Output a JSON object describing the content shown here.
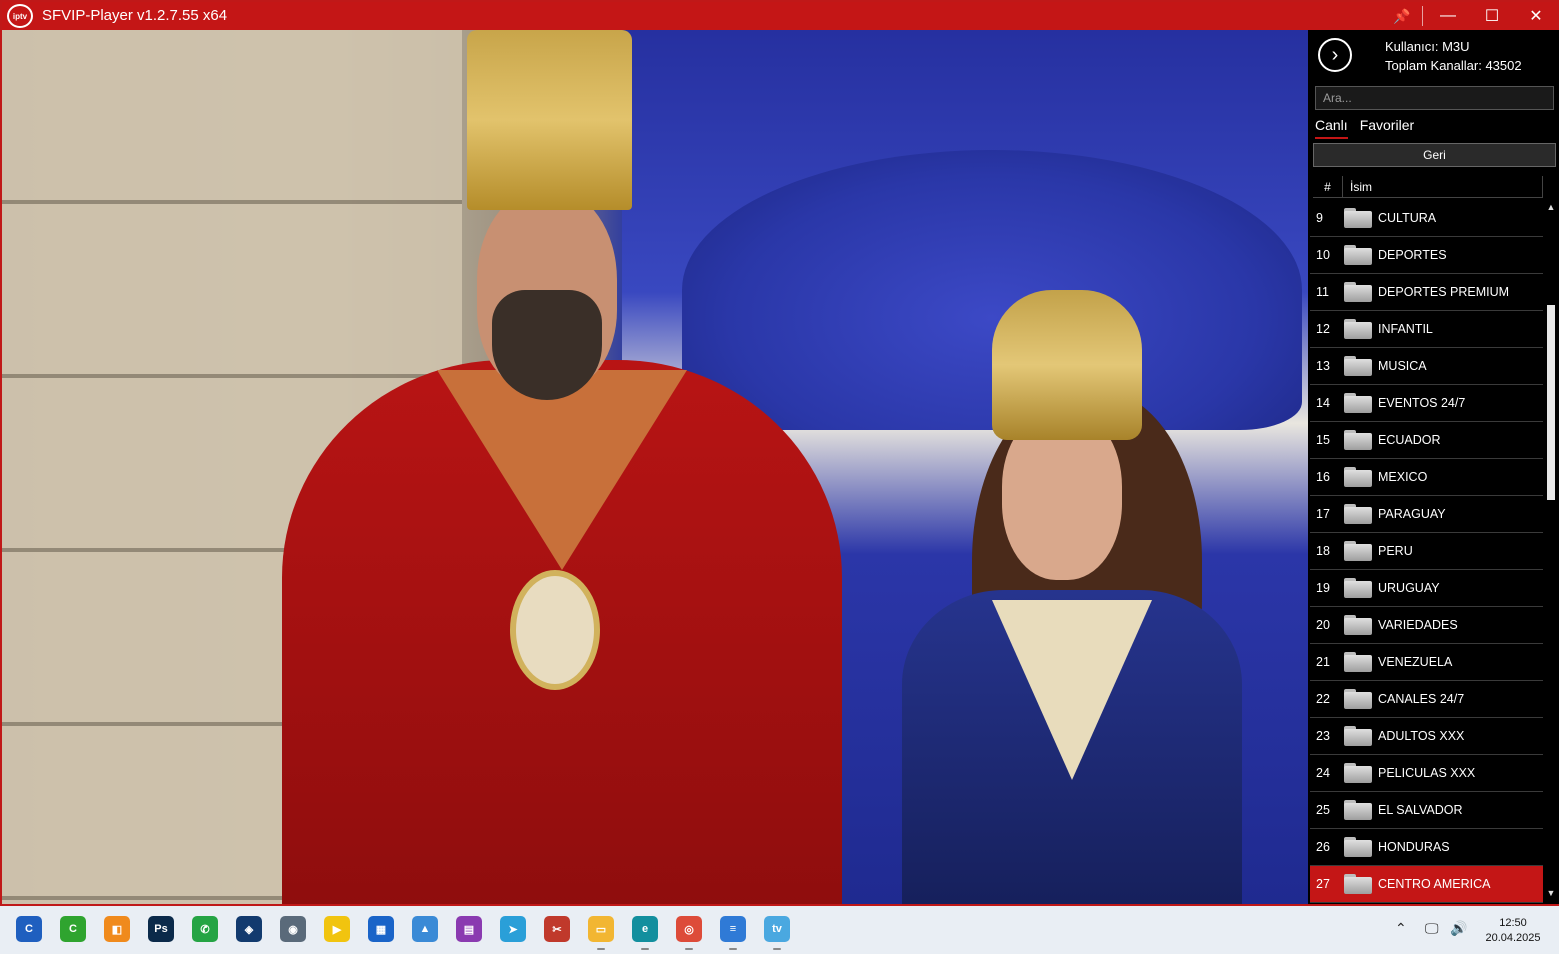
{
  "window": {
    "title": "SFVIP-Player v1.2.7.55 x64",
    "logo_text": "iptv",
    "accent": "#c41616"
  },
  "titlebar_buttons": {
    "pin": "📌",
    "minimize": "—",
    "maximize": "☐",
    "close": "✕"
  },
  "panel": {
    "nav_arrow": "›",
    "user_label": "Kullanıcı: M3U",
    "channels_label": "Toplam Kanallar: 43502",
    "search_placeholder": "Ara...",
    "tabs": [
      "Canlı",
      "Favoriler"
    ],
    "back_label": "Geri",
    "columns": {
      "num": "#",
      "name": "İsim"
    },
    "rows": [
      {
        "num": "9",
        "name": "CULTURA"
      },
      {
        "num": "10",
        "name": "DEPORTES"
      },
      {
        "num": "11",
        "name": "DEPORTES PREMIUM"
      },
      {
        "num": "12",
        "name": "INFANTIL"
      },
      {
        "num": "13",
        "name": "MUSICA"
      },
      {
        "num": "14",
        "name": "EVENTOS 24/7"
      },
      {
        "num": "15",
        "name": "ECUADOR"
      },
      {
        "num": "16",
        "name": "MEXICO"
      },
      {
        "num": "17",
        "name": "PARAGUAY"
      },
      {
        "num": "18",
        "name": "PERU"
      },
      {
        "num": "19",
        "name": "URUGUAY"
      },
      {
        "num": "20",
        "name": "VARIEDADES"
      },
      {
        "num": "21",
        "name": "VENEZUELA"
      },
      {
        "num": "22",
        "name": "CANALES 24/7"
      },
      {
        "num": "23",
        "name": "ADULTOS XXX"
      },
      {
        "num": "24",
        "name": "PELICULAS XXX"
      },
      {
        "num": "25",
        "name": "EL SALVADOR"
      },
      {
        "num": "26",
        "name": "HONDURAS"
      },
      {
        "num": "27",
        "name": "CENTRO AMERICA",
        "selected": true
      }
    ],
    "scroll_up": "▲",
    "scroll_down": "▼"
  },
  "taskbar": {
    "apps": [
      {
        "name": "ccleaner-icon",
        "color": "#1f5fbf",
        "glyph": "C"
      },
      {
        "name": "green-app-icon",
        "color": "#2fa42f",
        "glyph": "C"
      },
      {
        "name": "windows-sandbox-icon",
        "color": "#f08a1c",
        "glyph": "◧"
      },
      {
        "name": "photoshop-icon",
        "color": "#0b2a4a",
        "glyph": "Ps"
      },
      {
        "name": "whatsapp-icon",
        "color": "#25a444",
        "glyph": "✆"
      },
      {
        "name": "vpn-shield-icon",
        "color": "#123a6e",
        "glyph": "◈"
      },
      {
        "name": "camera-icon",
        "color": "#5a6a7a",
        "glyph": "◉"
      },
      {
        "name": "player-app-icon",
        "color": "#f1c40f",
        "glyph": "▶"
      },
      {
        "name": "microsoft-store-icon",
        "color": "#1a64c8",
        "glyph": "▦"
      },
      {
        "name": "photos-icon",
        "color": "#3a8ad6",
        "glyph": "▲"
      },
      {
        "name": "winrar-icon",
        "color": "#8a3ab0",
        "glyph": "▤"
      },
      {
        "name": "telegram-icon",
        "color": "#2a9fd8",
        "glyph": "➤"
      },
      {
        "name": "snipping-tool-icon",
        "color": "#c0392b",
        "glyph": "✂"
      },
      {
        "name": "file-explorer-icon",
        "color": "#f2b632",
        "glyph": "▭"
      },
      {
        "name": "edge-icon",
        "color": "#138f9e",
        "glyph": "e"
      },
      {
        "name": "chrome-icon",
        "color": "#dd4b39",
        "glyph": "◎"
      },
      {
        "name": "notepad-icon",
        "color": "#2f7ad6",
        "glyph": "≡"
      },
      {
        "name": "sfvip-taskbar-icon",
        "color": "#4aa8e0",
        "glyph": "tv"
      }
    ],
    "tray_chevron": "⌃",
    "tray_network": "🖵",
    "tray_volume": "🔊",
    "time": "12:50",
    "date": "20.04.2025"
  }
}
